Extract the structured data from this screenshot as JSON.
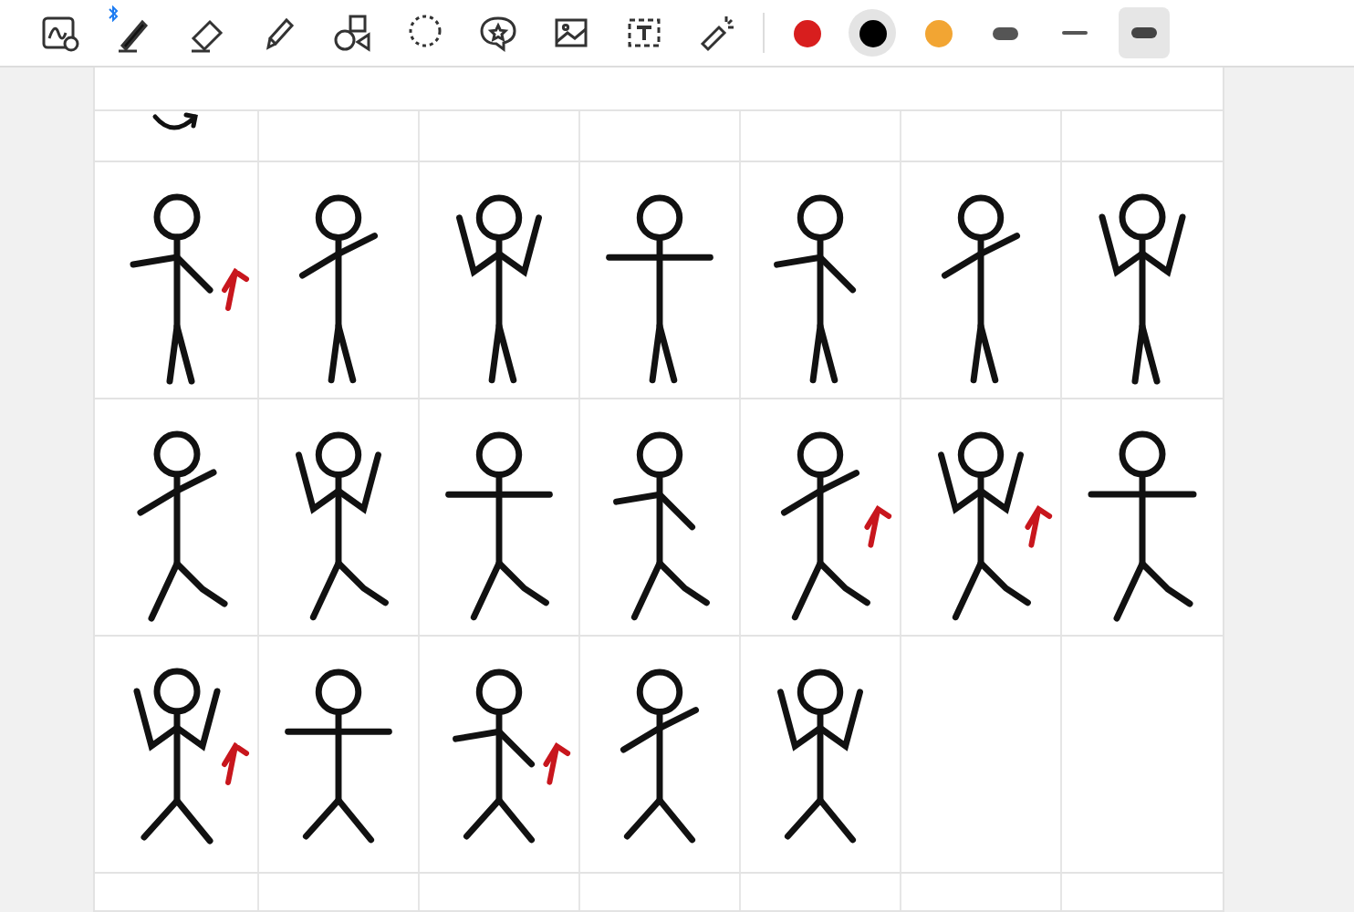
{
  "toolbar": {
    "tools": [
      {
        "kind": "zoom"
      },
      {
        "kind": "pen_connected"
      },
      {
        "kind": "eraser"
      },
      {
        "kind": "highlighter"
      },
      {
        "kind": "shapes"
      },
      {
        "kind": "lasso"
      },
      {
        "kind": "sticker"
      },
      {
        "kind": "image"
      },
      {
        "kind": "text"
      },
      {
        "kind": "laser"
      }
    ],
    "colors": [
      {
        "color": "#d81e1e",
        "selected": false
      },
      {
        "color": "#000000",
        "selected": true
      },
      {
        "color": "#f2a533",
        "selected": false
      }
    ],
    "strokes": [
      {
        "kind": "thick",
        "selected": false
      },
      {
        "kind": "thin",
        "selected": false
      },
      {
        "kind": "medium",
        "selected": true
      }
    ]
  },
  "sheet": {
    "rows": [
      {
        "kind": "strip",
        "cells": [
          {
            "kind": "arrow"
          },
          {
            "kind": "empty"
          },
          {
            "kind": "empty"
          },
          {
            "kind": "empty"
          },
          {
            "kind": "empty"
          },
          {
            "kind": "empty"
          },
          {
            "kind": "empty"
          }
        ]
      },
      {
        "kind": "full",
        "cells": [
          {
            "kind": "marked"
          },
          {
            "kind": "figure"
          },
          {
            "kind": "figure"
          },
          {
            "kind": "figure"
          },
          {
            "kind": "figure"
          },
          {
            "kind": "figure"
          },
          {
            "kind": "figure"
          }
        ]
      },
      {
        "kind": "full",
        "cells": [
          {
            "kind": "figure"
          },
          {
            "kind": "figure"
          },
          {
            "kind": "figure"
          },
          {
            "kind": "figure"
          },
          {
            "kind": "marked"
          },
          {
            "kind": "marked"
          },
          {
            "kind": "figure"
          }
        ]
      },
      {
        "kind": "full",
        "cells": [
          {
            "kind": "marked"
          },
          {
            "kind": "figure"
          },
          {
            "kind": "marked"
          },
          {
            "kind": "figure"
          },
          {
            "kind": "figure"
          },
          {
            "kind": "empty"
          },
          {
            "kind": "empty"
          }
        ]
      },
      {
        "kind": "cut",
        "cells": [
          {
            "kind": "empty"
          },
          {
            "kind": "empty"
          },
          {
            "kind": "empty"
          },
          {
            "kind": "empty"
          },
          {
            "kind": "empty"
          },
          {
            "kind": "empty"
          },
          {
            "kind": "empty"
          }
        ]
      }
    ]
  }
}
